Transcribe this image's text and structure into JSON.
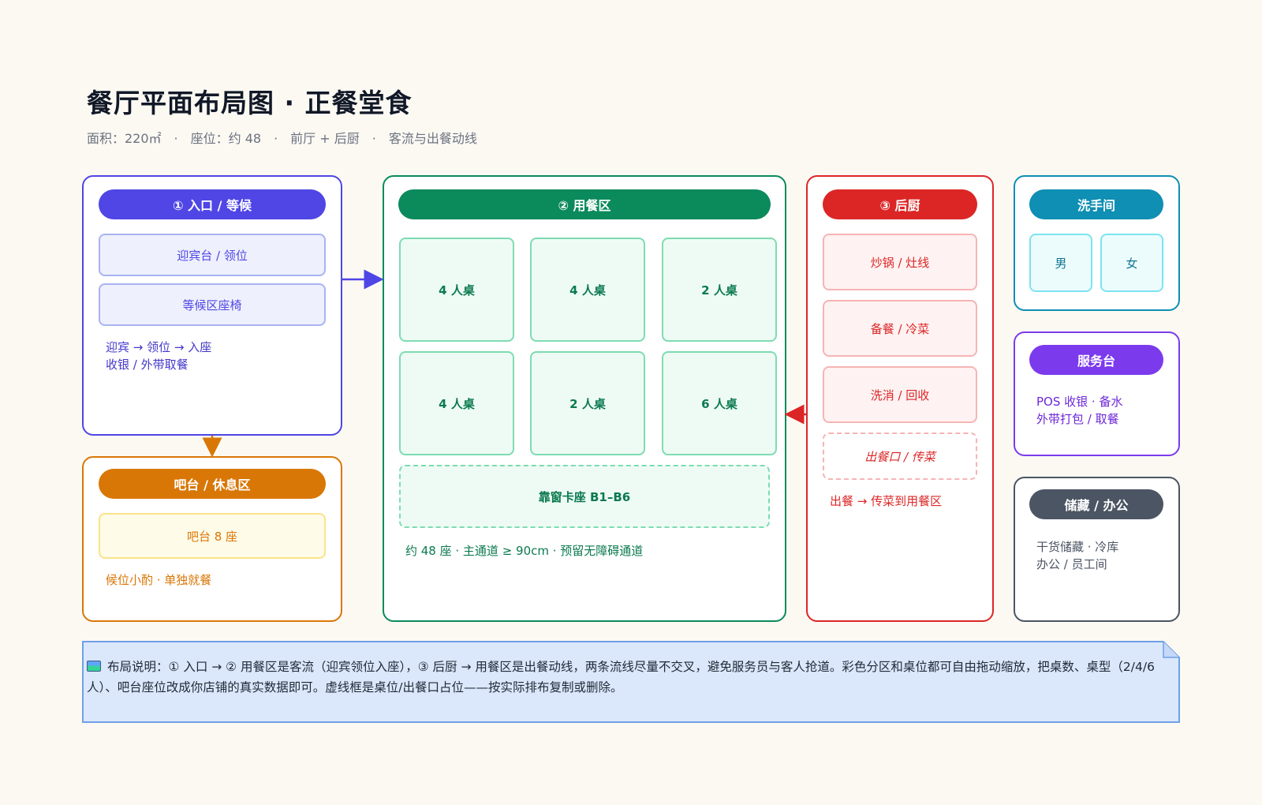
{
  "title": "餐厅平面布局图 · 正餐堂食",
  "subtitle": "面积：220㎡　·　座位：约 48　·　前厅 + 后厨　·　客流与出餐动线",
  "colors": {
    "entrance": "#4f46e5",
    "dining": "#0b8a5c",
    "kitchen": "#dc2626",
    "restroom": "#0e8fb3",
    "service": "#7c3aed",
    "storage": "#4b5563",
    "bar": "#d97706",
    "callout_bg": "#dbe8fb",
    "callout_border": "#6fa0e8"
  },
  "entrance": {
    "header": "① 入口 / 等候",
    "items": [
      "迎宾台 / 领位",
      "等候区座椅"
    ],
    "note_line1": "迎宾 → 领位 → 入座",
    "note_line2": "收银 / 外带取餐"
  },
  "bar": {
    "header": "吧台 / 休息区",
    "item": "吧台 8 座",
    "note": "候位小酌 · 单独就餐"
  },
  "dining": {
    "header": "② 用餐区",
    "tables": [
      "4 人桌",
      "4 人桌",
      "2 人桌",
      "4 人桌",
      "2 人桌",
      "6 人桌"
    ],
    "booth": "靠窗卡座 B1–B6",
    "note": "约 48 座 · 主通道 ≥ 90cm · 预留无障碍通道"
  },
  "kitchen": {
    "header": "③ 后厨",
    "items": [
      "炒锅 / 灶线",
      "备餐 / 冷菜",
      "洗消 / 回收"
    ],
    "pass": "出餐口 / 传菜",
    "note": "出餐 → 传菜到用餐区"
  },
  "restroom": {
    "header": "洗手间",
    "male": "男",
    "female": "女"
  },
  "service": {
    "header": "服务台",
    "note_line1": "POS 收银 · 备水",
    "note_line2": "外带打包 / 取餐"
  },
  "storage": {
    "header": "储藏 / 办公",
    "note_line1": "干货储藏 · 冷库",
    "note_line2": "办公 / 员工间"
  },
  "callout": {
    "icon": "map-icon",
    "text": "布局说明：① 入口 → ② 用餐区是客流（迎宾领位入座），③ 后厨 → 用餐区是出餐动线，两条流线尽量不交叉，避免服务员与客人抢道。彩色分区和桌位都可自由拖动缩放，把桌数、桌型（2/4/6 人）、吧台座位改成你店铺的真实数据即可。虚线框是桌位/出餐口占位——按实际排布复制或删除。"
  }
}
